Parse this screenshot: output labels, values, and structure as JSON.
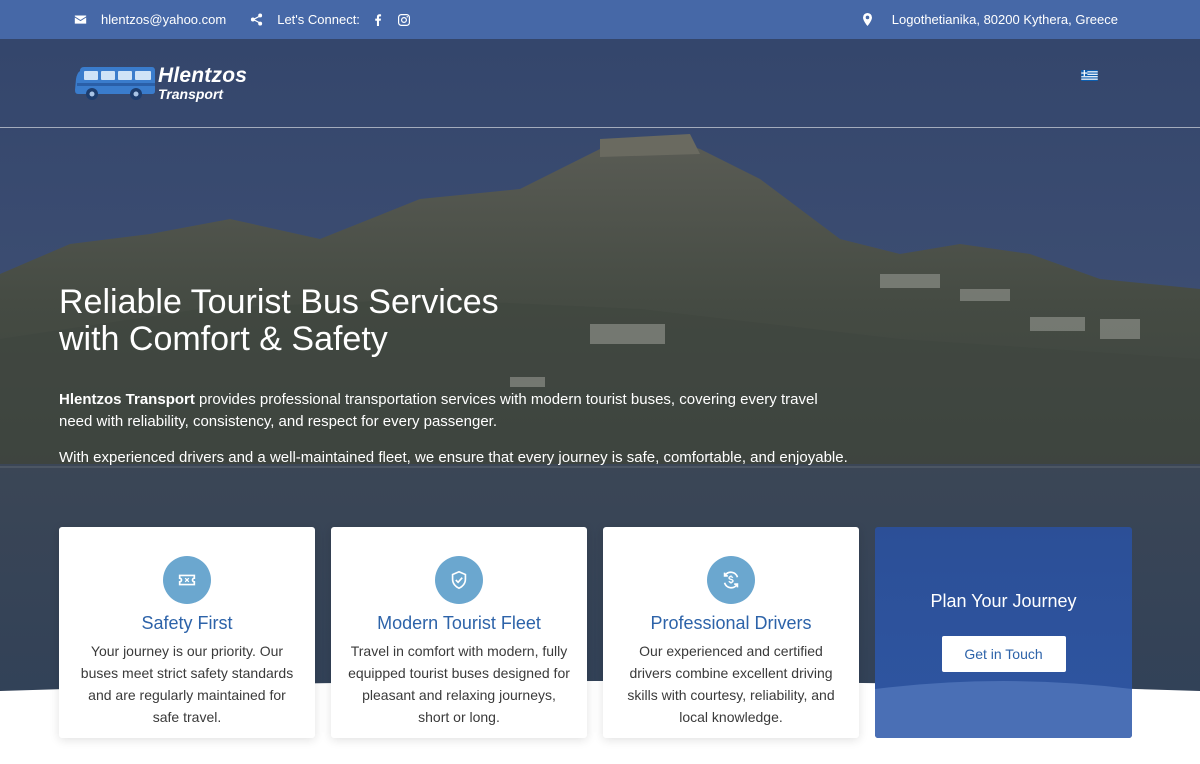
{
  "topbar": {
    "email": "hlentzos@yahoo.com",
    "connect_label": "Let's Connect:",
    "address": "Logothetianika, 80200 Kythera, Greece",
    "icons": [
      "envelope-icon",
      "share-icon",
      "facebook-icon",
      "instagram-icon",
      "map-pin-icon"
    ]
  },
  "brand": {
    "name_line1": "Hlentzos",
    "name_line2": "Transport",
    "language_flag": "greek-flag-icon"
  },
  "hero": {
    "headline_line1": "Reliable Tourist Bus Services",
    "headline_line2": "with Comfort & Safety",
    "para1_bold": "Hlentzos Transport",
    "para1_rest": " provides professional transportation services with modern tourist buses, covering every travel need with reliability, consistency, and respect for every passenger.",
    "para2": "With experienced drivers and a well-maintained fleet, we ensure that every journey is safe, comfortable, and enjoyable."
  },
  "features": [
    {
      "icon": "ticket-icon",
      "title": "Safety First",
      "text": "Your journey is our priority. Our buses meet strict safety standards and are regularly maintained for safe travel."
    },
    {
      "icon": "shield-check-icon",
      "title": "Modern Tourist Fleet",
      "text": "Travel in comfort with modern, fully equipped tourist buses designed for pleasant and relaxing journeys, short or long."
    },
    {
      "icon": "refresh-dollar-icon",
      "title": "Professional Drivers",
      "text": "Our experienced and certified drivers combine excellent driving skills with courtesy, reliability, and local knowledge."
    }
  ],
  "cta": {
    "title": "Plan Your Journey",
    "button": "Get in Touch"
  },
  "colors": {
    "topbar": "#4668a7",
    "accent": "#2d63a9",
    "icon_circle": "#6ba7cf",
    "cta_bg": "#2c4f97"
  }
}
